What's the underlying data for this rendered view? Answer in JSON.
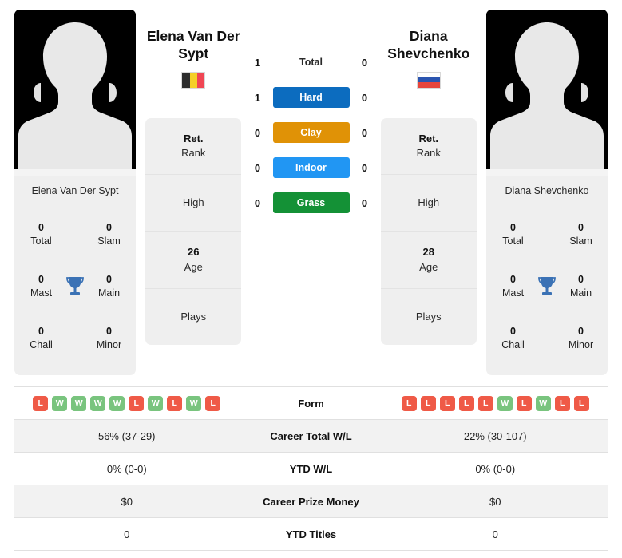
{
  "players": {
    "left": {
      "name": "Elena Van Der Sypt",
      "name_display": "Elena Van Der Sypt",
      "flag_country": "Belgium",
      "flag_type": "vertical",
      "flag_colors": [
        "#2c2c2c",
        "#f5d028",
        "#f04654"
      ],
      "avatar": "default-player-silhouette",
      "titles": {
        "total": "0",
        "total_label": "Total",
        "slam": "0",
        "slam_label": "Slam",
        "mast": "0",
        "mast_label": "Mast",
        "main": "0",
        "main_label": "Main",
        "chall": "0",
        "chall_label": "Chall",
        "minor": "0",
        "minor_label": "Minor",
        "icon": "trophy-icon"
      },
      "info": {
        "rank_value": "Ret.",
        "rank_label": "Rank",
        "high_label": "High",
        "high_value": "",
        "age_value": "26",
        "age_label": "Age",
        "plays_label": "Plays",
        "plays_value": ""
      },
      "form": [
        "L",
        "W",
        "W",
        "W",
        "W",
        "L",
        "W",
        "L",
        "W",
        "L"
      ],
      "career_wl": "56% (37-29)",
      "ytd_wl": "0% (0-0)",
      "career_prize": "$0",
      "ytd_titles": "0"
    },
    "right": {
      "name": "Diana Shevchenko",
      "name_display": "Diana Shevchenko",
      "flag_country": "Russia",
      "flag_type": "horizontal",
      "flag_colors": [
        "#ffffff",
        "#2b55b0",
        "#e8453c"
      ],
      "avatar": "default-player-silhouette",
      "titles": {
        "total": "0",
        "total_label": "Total",
        "slam": "0",
        "slam_label": "Slam",
        "mast": "0",
        "mast_label": "Mast",
        "main": "0",
        "main_label": "Main",
        "chall": "0",
        "chall_label": "Chall",
        "minor": "0",
        "minor_label": "Minor",
        "icon": "trophy-icon"
      },
      "info": {
        "rank_value": "Ret.",
        "rank_label": "Rank",
        "high_label": "High",
        "high_value": "",
        "age_value": "28",
        "age_label": "Age",
        "plays_label": "Plays",
        "plays_value": ""
      },
      "form": [
        "L",
        "L",
        "L",
        "L",
        "L",
        "W",
        "L",
        "W",
        "L",
        "L"
      ],
      "career_wl": "22% (30-107)",
      "ytd_wl": "0% (0-0)",
      "career_prize": "$0",
      "ytd_titles": "0"
    }
  },
  "head_to_head": [
    {
      "label": "Total",
      "left": "1",
      "right": "0",
      "color": null,
      "badge": false
    },
    {
      "label": "Hard",
      "left": "1",
      "right": "0",
      "color": "#0c6cbf",
      "badge": true
    },
    {
      "label": "Clay",
      "left": "0",
      "right": "0",
      "color": "#e09206",
      "badge": true
    },
    {
      "label": "Indoor",
      "left": "0",
      "right": "0",
      "color": "#2196f3",
      "badge": true
    },
    {
      "label": "Grass",
      "left": "0",
      "right": "0",
      "color": "#149136",
      "badge": true
    }
  ],
  "stats_table": [
    {
      "label": "Form",
      "type": "form"
    },
    {
      "label": "Career Total W/L",
      "type": "text",
      "left": "56% (37-29)",
      "right": "22% (30-107)"
    },
    {
      "label": "YTD W/L",
      "type": "text",
      "left": "0% (0-0)",
      "right": "0% (0-0)"
    },
    {
      "label": "Career Prize Money",
      "type": "text",
      "left": "$0",
      "right": "$0"
    },
    {
      "label": "YTD Titles",
      "type": "text",
      "left": "0",
      "right": "0"
    }
  ],
  "colors": {
    "win": "#79c47e",
    "loss": "#ef5a47",
    "card_bg": "#efefef",
    "row_alt": "#f2f2f2",
    "trophy": "#3b72b5"
  }
}
